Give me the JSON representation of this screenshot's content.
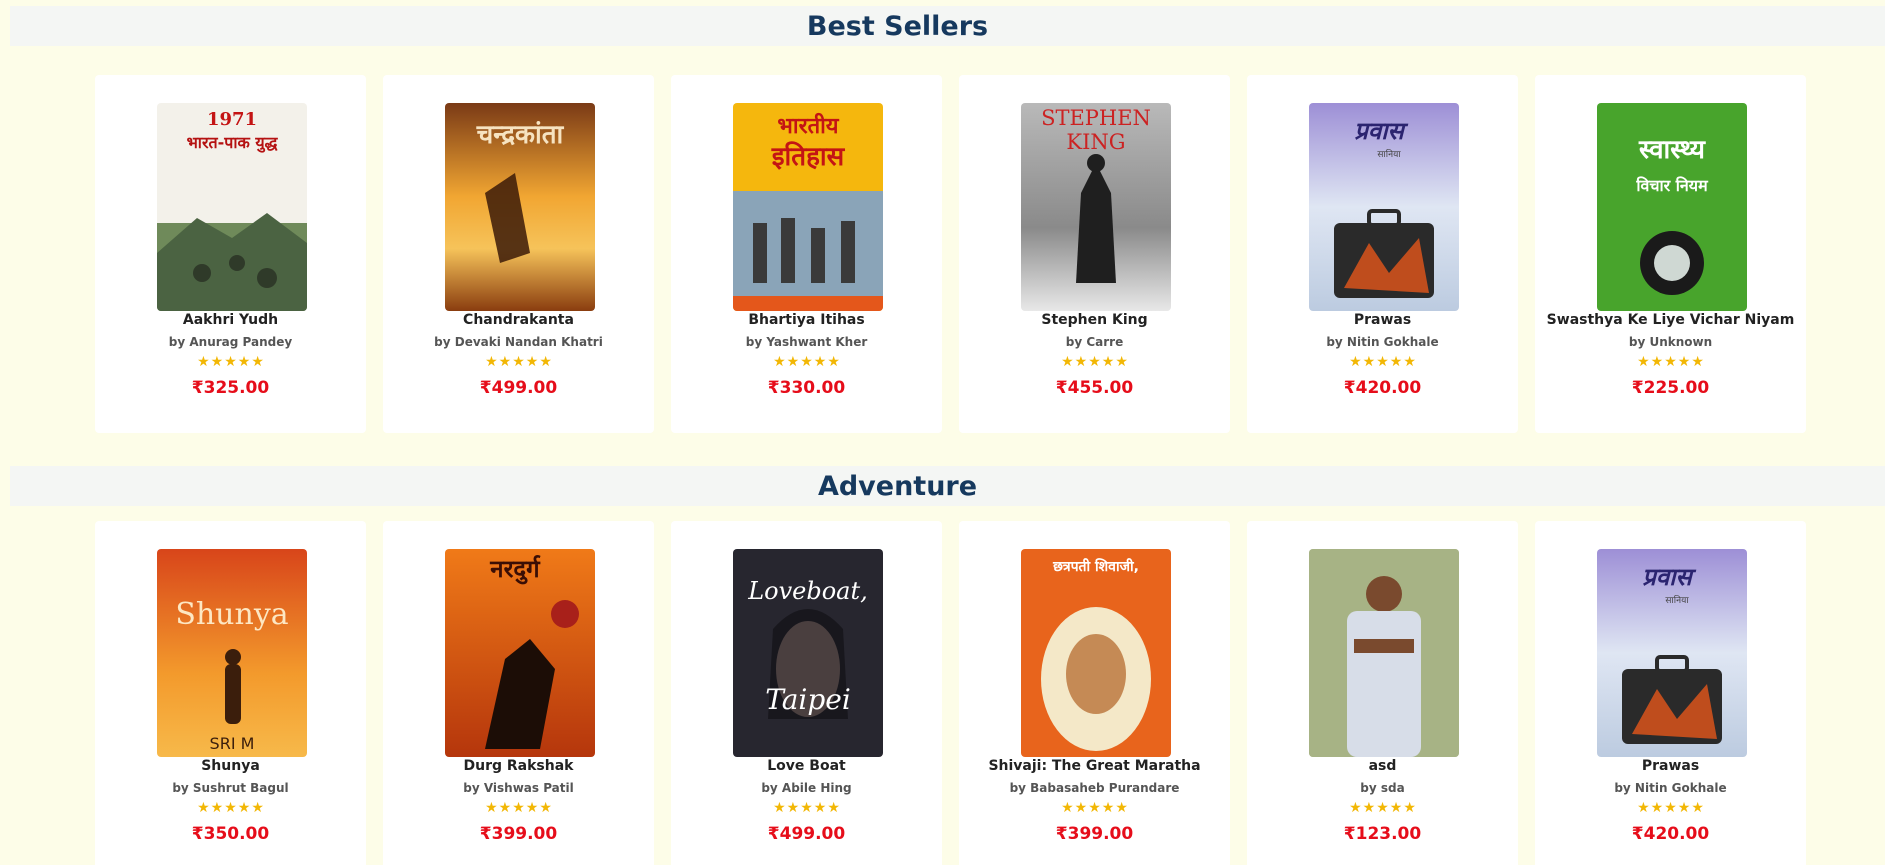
{
  "sections": [
    {
      "title": "Best Sellers",
      "books": [
        {
          "title": "Aakhri Yudh",
          "author": "by Anurag Pandey",
          "price": "₹325.00",
          "cover_text": "1971",
          "cover_sub": "भारत-पाक युद्ध"
        },
        {
          "title": "Chandrakanta",
          "author": "by Devaki Nandan Khatri",
          "price": "₹499.00",
          "cover_text": "चन्द्रकांता",
          "cover_sub": ""
        },
        {
          "title": "Bhartiya Itihas",
          "author": "by Yashwant Kher",
          "price": "₹330.00",
          "cover_text": "भारतीय",
          "cover_sub": "इतिहास"
        },
        {
          "title": "Stephen King",
          "author": "by Carre",
          "price": "₹455.00",
          "cover_text": "STEPHEN",
          "cover_sub": "KING"
        },
        {
          "title": "Prawas",
          "author": "by Nitin Gokhale",
          "price": "₹420.00",
          "cover_text": "प्रवास",
          "cover_sub": "सानिया"
        },
        {
          "title": "Swasthya Ke Liye Vichar Niyam",
          "author": "by Unknown",
          "price": "₹225.00",
          "cover_text": "स्वास्थ्य",
          "cover_sub": "विचार नियम"
        }
      ]
    },
    {
      "title": "Adventure",
      "books": [
        {
          "title": "Shunya",
          "author": "by Sushrut Bagul",
          "price": "₹350.00",
          "cover_text": "Shunya",
          "cover_sub": "SRI M"
        },
        {
          "title": "Durg Rakshak",
          "author": "by Vishwas Patil",
          "price": "₹399.00",
          "cover_text": "नरदुर्ग",
          "cover_sub": ""
        },
        {
          "title": "Love Boat",
          "author": "by Abile Hing",
          "price": "₹499.00",
          "cover_text": "Loveboat,",
          "cover_sub": "Taipei"
        },
        {
          "title": "Shivaji: The Great Maratha",
          "author": "by Babasaheb Purandare",
          "price": "₹399.00",
          "cover_text": "छत्रपती शिवाजी,",
          "cover_sub": ""
        },
        {
          "title": "asd",
          "author": "by sda",
          "price": "₹123.00",
          "cover_text": "",
          "cover_sub": ""
        },
        {
          "title": "Prawas",
          "author": "by Nitin Gokhale",
          "price": "₹420.00",
          "cover_text": "प्रवास",
          "cover_sub": "सानिया"
        }
      ]
    }
  ],
  "rating_stars": "★",
  "icons": {
    "prev": "chevron-left-icon",
    "next": "chevron-right-icon",
    "star": "star-icon"
  },
  "colors": {
    "title": "#16395e",
    "price": "#e60d1a",
    "star": "#f2b705",
    "background": "#fdfde8"
  }
}
